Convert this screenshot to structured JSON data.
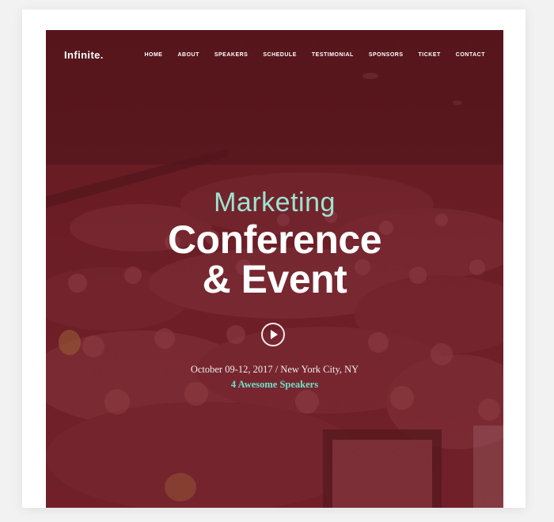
{
  "brand": {
    "logo": "Infinite."
  },
  "nav": {
    "items": [
      "HOME",
      "ABOUT",
      "SPEAKERS",
      "SCHEDULE",
      "TESTIMONIAL",
      "SPONSORS",
      "TICKET",
      "CONTACT"
    ]
  },
  "hero": {
    "kicker": "Marketing",
    "title_line1": "Conference",
    "title_line2": "& Event",
    "date_location": "October 09-12, 2017 / New York City, NY",
    "speakers_link": "4 Awesome Speakers"
  },
  "colors": {
    "overlay": "#6b2029",
    "accent": "#6fe0c9",
    "text": "#ffffff"
  },
  "icons": {
    "play": "play-icon"
  }
}
